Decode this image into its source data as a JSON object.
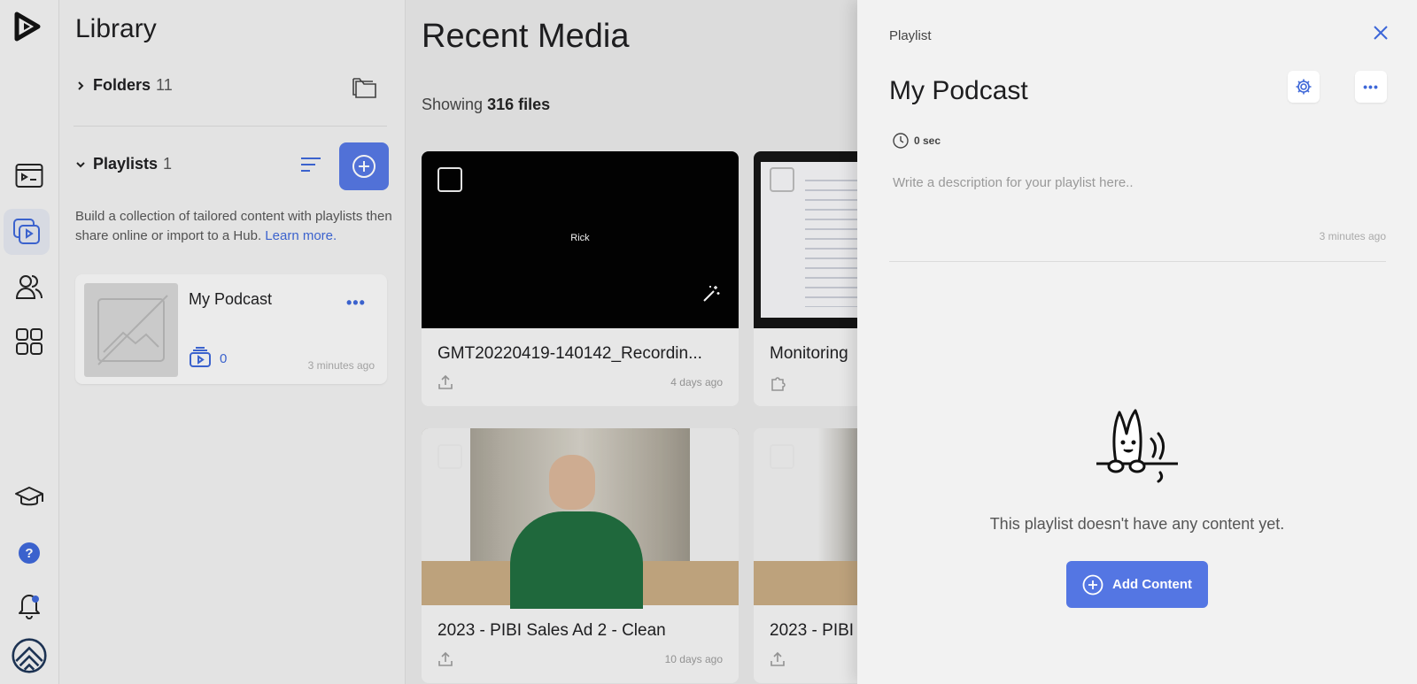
{
  "library": {
    "title": "Library",
    "folders": {
      "label": "Folders",
      "count": "11"
    },
    "playlists": {
      "label": "Playlists",
      "count": "1"
    },
    "description": "Build a collection of tailored content with playlists then share online or import to a Hub.",
    "learn_more": "Learn more.",
    "playlist_card": {
      "name": "My Podcast",
      "item_count": "0",
      "time": "3 minutes ago"
    }
  },
  "main": {
    "title": "Recent Media",
    "showing_prefix": "Showing",
    "showing_count": "316 files",
    "media": [
      {
        "title": "GMT20220419-140142_Recordin...",
        "time": "4 days ago",
        "thumb_text": "Rick"
      },
      {
        "title": "Monitoring",
        "time": ""
      },
      {
        "title": "2023 - PIBI Sales Ad 2 - Clean",
        "time": "10 days ago"
      },
      {
        "title": "2023 - PIBI",
        "time": ""
      }
    ]
  },
  "panel": {
    "breadcrumb": "Playlist",
    "title": "My Podcast",
    "duration": "0 sec",
    "description_placeholder": "Write a description for your playlist here..",
    "time": "3 minutes ago",
    "empty_message": "This playlist doesn't have any content yet.",
    "add_content_label": "Add Content"
  },
  "colors": {
    "accent": "#5476e3",
    "link": "#3d67d8"
  }
}
